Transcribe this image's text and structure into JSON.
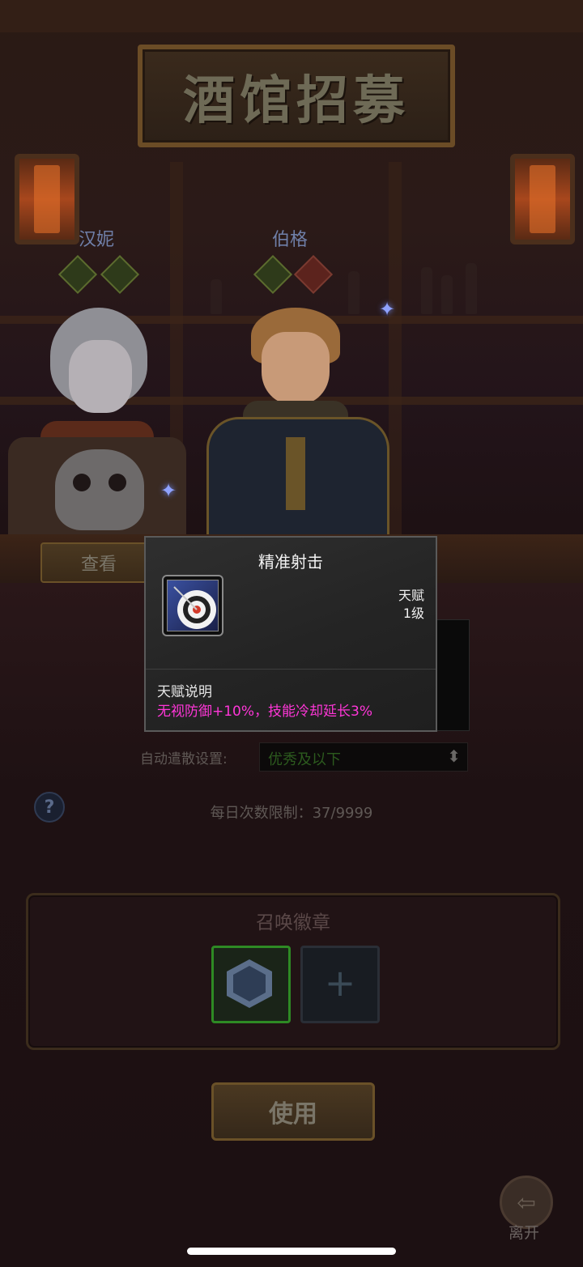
{
  "title": "酒馆招募",
  "heroes": [
    {
      "name": "汉妮"
    },
    {
      "name": "伯格"
    }
  ],
  "view_button": "查看",
  "tooltip": {
    "skill_name": "精准射击",
    "category": "天赋",
    "level": "1级",
    "section_label": "天赋说明",
    "description": "无视防御+10%，技能冷却延长3%"
  },
  "auto_dismiss": {
    "label": "自动遣散设置:",
    "value": "优秀及以下"
  },
  "daily_limit": "每日次数限制：37/9999",
  "summon": {
    "title": "召唤徽章",
    "empty_slot_symbol": "+"
  },
  "use_button": "使用",
  "leave_label": "离开",
  "icons": {
    "help": "question-icon",
    "trait_1": "dragon-trait-icon",
    "trait_2": "crossed-swords-trait-icon",
    "trait_3": "mask-trait-icon",
    "trait_4": "shield-trait-icon",
    "skill": "target-icon",
    "badge": "helmet-badge-icon",
    "leave": "exit-door-icon"
  },
  "colors": {
    "description": "#ff36d8",
    "selected_slot": "#2e8a24",
    "select_value": "#2c5a1e"
  }
}
